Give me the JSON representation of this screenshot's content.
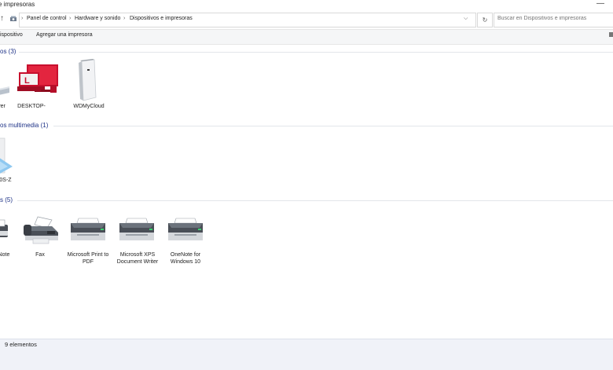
{
  "window": {
    "title": "e impresoras",
    "minimize": "—"
  },
  "nav": {
    "up_arrow": "↑",
    "breadcrumbs": [
      "Panel de control",
      "Hardware y sonido",
      "Dispositivos e impresoras"
    ],
    "search_placeholder": "Buscar en Dispositivos e impresoras"
  },
  "command_bar": {
    "add_device": "ispositivo",
    "add_printer": "Agregar una impresora"
  },
  "groups": [
    {
      "title": "os (3)",
      "items": [
        {
          "label": "ver",
          "icon": "monitor-icon"
        },
        {
          "label": "DESKTOP-",
          "icon": "computer-icon"
        },
        {
          "label": "WDMyCloud",
          "icon": "nas-drive-icon"
        }
      ]
    },
    {
      "title": "os multimedia (1)",
      "items": [
        {
          "label": "0S-Z",
          "icon": "media-device-icon"
        }
      ]
    },
    {
      "title": "s (5)",
      "items": [
        {
          "label": "Note",
          "icon": "printer-icon"
        },
        {
          "label": "Fax",
          "icon": "fax-icon"
        },
        {
          "label": "Microsoft Print to PDF",
          "icon": "printer-icon"
        },
        {
          "label": "Microsoft XPS Document Writer",
          "icon": "printer-icon"
        },
        {
          "label": "OneNote for Windows 10",
          "icon": "printer-icon"
        }
      ]
    }
  ],
  "status": {
    "count": "9 elementos"
  },
  "colors": {
    "group_title": "#1e3287",
    "accent_red": "#c8102e",
    "status_bg": "#f0f2f8"
  }
}
